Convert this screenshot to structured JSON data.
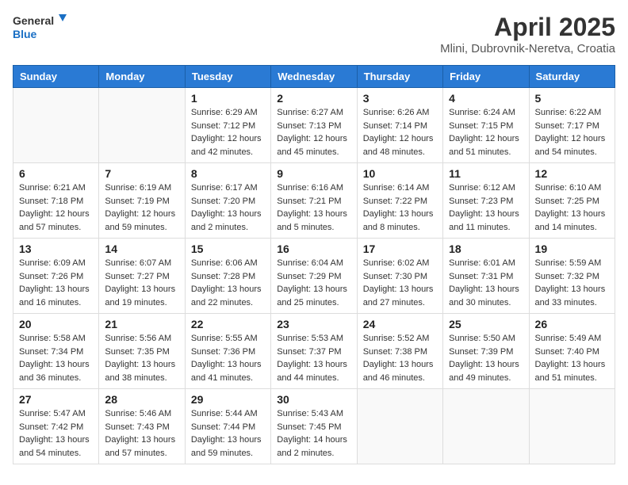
{
  "header": {
    "logo_general": "General",
    "logo_blue": "Blue",
    "title": "April 2025",
    "location": "Mlini, Dubrovnik-Neretva, Croatia"
  },
  "days_of_week": [
    "Sunday",
    "Monday",
    "Tuesday",
    "Wednesday",
    "Thursday",
    "Friday",
    "Saturday"
  ],
  "weeks": [
    [
      {
        "day": "",
        "info": ""
      },
      {
        "day": "",
        "info": ""
      },
      {
        "day": "1",
        "info": "Sunrise: 6:29 AM\nSunset: 7:12 PM\nDaylight: 12 hours and 42 minutes."
      },
      {
        "day": "2",
        "info": "Sunrise: 6:27 AM\nSunset: 7:13 PM\nDaylight: 12 hours and 45 minutes."
      },
      {
        "day": "3",
        "info": "Sunrise: 6:26 AM\nSunset: 7:14 PM\nDaylight: 12 hours and 48 minutes."
      },
      {
        "day": "4",
        "info": "Sunrise: 6:24 AM\nSunset: 7:15 PM\nDaylight: 12 hours and 51 minutes."
      },
      {
        "day": "5",
        "info": "Sunrise: 6:22 AM\nSunset: 7:17 PM\nDaylight: 12 hours and 54 minutes."
      }
    ],
    [
      {
        "day": "6",
        "info": "Sunrise: 6:21 AM\nSunset: 7:18 PM\nDaylight: 12 hours and 57 minutes."
      },
      {
        "day": "7",
        "info": "Sunrise: 6:19 AM\nSunset: 7:19 PM\nDaylight: 12 hours and 59 minutes."
      },
      {
        "day": "8",
        "info": "Sunrise: 6:17 AM\nSunset: 7:20 PM\nDaylight: 13 hours and 2 minutes."
      },
      {
        "day": "9",
        "info": "Sunrise: 6:16 AM\nSunset: 7:21 PM\nDaylight: 13 hours and 5 minutes."
      },
      {
        "day": "10",
        "info": "Sunrise: 6:14 AM\nSunset: 7:22 PM\nDaylight: 13 hours and 8 minutes."
      },
      {
        "day": "11",
        "info": "Sunrise: 6:12 AM\nSunset: 7:23 PM\nDaylight: 13 hours and 11 minutes."
      },
      {
        "day": "12",
        "info": "Sunrise: 6:10 AM\nSunset: 7:25 PM\nDaylight: 13 hours and 14 minutes."
      }
    ],
    [
      {
        "day": "13",
        "info": "Sunrise: 6:09 AM\nSunset: 7:26 PM\nDaylight: 13 hours and 16 minutes."
      },
      {
        "day": "14",
        "info": "Sunrise: 6:07 AM\nSunset: 7:27 PM\nDaylight: 13 hours and 19 minutes."
      },
      {
        "day": "15",
        "info": "Sunrise: 6:06 AM\nSunset: 7:28 PM\nDaylight: 13 hours and 22 minutes."
      },
      {
        "day": "16",
        "info": "Sunrise: 6:04 AM\nSunset: 7:29 PM\nDaylight: 13 hours and 25 minutes."
      },
      {
        "day": "17",
        "info": "Sunrise: 6:02 AM\nSunset: 7:30 PM\nDaylight: 13 hours and 27 minutes."
      },
      {
        "day": "18",
        "info": "Sunrise: 6:01 AM\nSunset: 7:31 PM\nDaylight: 13 hours and 30 minutes."
      },
      {
        "day": "19",
        "info": "Sunrise: 5:59 AM\nSunset: 7:32 PM\nDaylight: 13 hours and 33 minutes."
      }
    ],
    [
      {
        "day": "20",
        "info": "Sunrise: 5:58 AM\nSunset: 7:34 PM\nDaylight: 13 hours and 36 minutes."
      },
      {
        "day": "21",
        "info": "Sunrise: 5:56 AM\nSunset: 7:35 PM\nDaylight: 13 hours and 38 minutes."
      },
      {
        "day": "22",
        "info": "Sunrise: 5:55 AM\nSunset: 7:36 PM\nDaylight: 13 hours and 41 minutes."
      },
      {
        "day": "23",
        "info": "Sunrise: 5:53 AM\nSunset: 7:37 PM\nDaylight: 13 hours and 44 minutes."
      },
      {
        "day": "24",
        "info": "Sunrise: 5:52 AM\nSunset: 7:38 PM\nDaylight: 13 hours and 46 minutes."
      },
      {
        "day": "25",
        "info": "Sunrise: 5:50 AM\nSunset: 7:39 PM\nDaylight: 13 hours and 49 minutes."
      },
      {
        "day": "26",
        "info": "Sunrise: 5:49 AM\nSunset: 7:40 PM\nDaylight: 13 hours and 51 minutes."
      }
    ],
    [
      {
        "day": "27",
        "info": "Sunrise: 5:47 AM\nSunset: 7:42 PM\nDaylight: 13 hours and 54 minutes."
      },
      {
        "day": "28",
        "info": "Sunrise: 5:46 AM\nSunset: 7:43 PM\nDaylight: 13 hours and 57 minutes."
      },
      {
        "day": "29",
        "info": "Sunrise: 5:44 AM\nSunset: 7:44 PM\nDaylight: 13 hours and 59 minutes."
      },
      {
        "day": "30",
        "info": "Sunrise: 5:43 AM\nSunset: 7:45 PM\nDaylight: 14 hours and 2 minutes."
      },
      {
        "day": "",
        "info": ""
      },
      {
        "day": "",
        "info": ""
      },
      {
        "day": "",
        "info": ""
      }
    ]
  ]
}
